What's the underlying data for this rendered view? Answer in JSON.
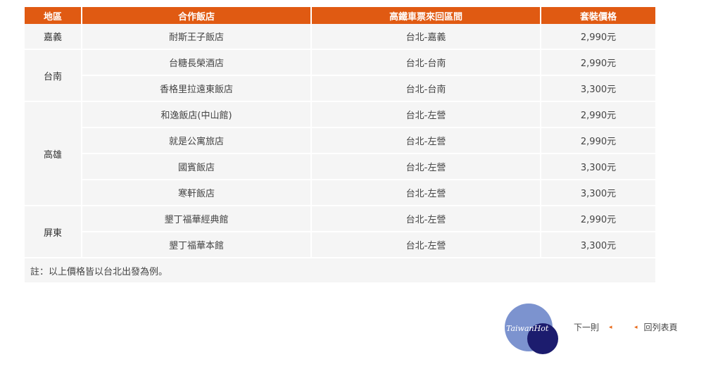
{
  "table": {
    "headers": [
      "地區",
      "合作飯店",
      "高鐵車票來回區間",
      "套裝價格"
    ],
    "groups": [
      {
        "region": "嘉義",
        "rows": [
          {
            "hotel": "耐斯王子飯店",
            "route": "台北-嘉義",
            "price": "2,990元"
          }
        ]
      },
      {
        "region": "台南",
        "rows": [
          {
            "hotel": "台糖長榮酒店",
            "route": "台北-台南",
            "price": "2,990元"
          },
          {
            "hotel": "香格里拉遠東飯店",
            "route": "台北-台南",
            "price": "3,300元"
          }
        ]
      },
      {
        "region": "高雄",
        "rows": [
          {
            "hotel": "和逸飯店(中山館)",
            "route": "台北-左營",
            "price": "2,990元"
          },
          {
            "hotel": "就是公寓旅店",
            "route": "台北-左營",
            "price": "2,990元"
          },
          {
            "hotel": "國賓飯店",
            "route": "台北-左營",
            "price": "3,300元"
          },
          {
            "hotel": "寒軒飯店",
            "route": "台北-左營",
            "price": "3,300元"
          }
        ]
      },
      {
        "region": "屏東",
        "rows": [
          {
            "hotel": "墾丁福華經典館",
            "route": "台北-左營",
            "price": "2,990元"
          },
          {
            "hotel": "墾丁福華本館",
            "route": "台北-左營",
            "price": "3,300元"
          }
        ]
      }
    ],
    "note": "註：以上價格皆以台北出發為例。"
  },
  "logo": {
    "text": "TaiwanHot"
  },
  "nav": {
    "prev_label": "下一則",
    "home_label": "回列表頁",
    "prev_arrow": "◂",
    "home_arrow": "◂"
  },
  "colors": {
    "header_bg": "#e05a12",
    "row_bg": "#f5f5f5",
    "arrow": "#e86a1a",
    "logo_light": "#7c93cf",
    "logo_dark": "#1c1c6e"
  }
}
